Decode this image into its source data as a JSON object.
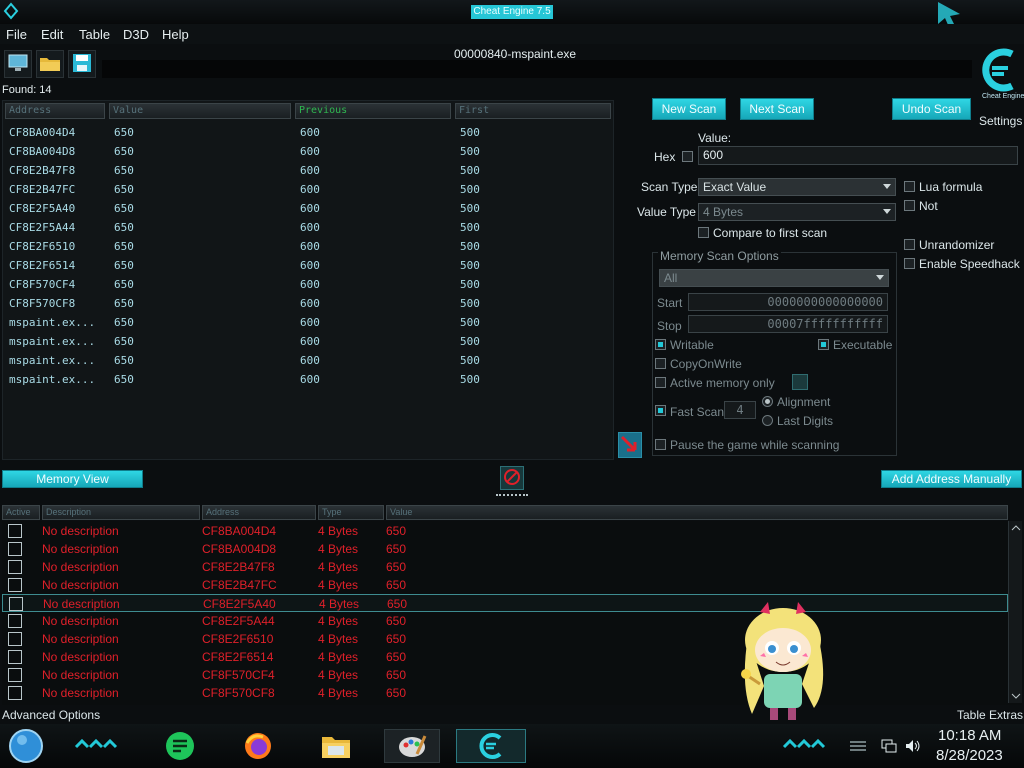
{
  "window": {
    "title": "Cheat Engine 7.5",
    "process": "00000840-mspaint.exe"
  },
  "menu": [
    "File",
    "Edit",
    "Table",
    "D3D",
    "Help"
  ],
  "toolbar": {
    "icons": [
      "open-process-icon",
      "open-file-icon",
      "save-icon"
    ]
  },
  "found": "Found: 14",
  "results": {
    "columns": [
      "Address",
      "Value",
      "Previous",
      "First"
    ],
    "rows": [
      [
        "CF8BA004D4",
        "650",
        "600",
        "500"
      ],
      [
        "CF8BA004D8",
        "650",
        "600",
        "500"
      ],
      [
        "CF8E2B47F8",
        "650",
        "600",
        "500"
      ],
      [
        "CF8E2B47FC",
        "650",
        "600",
        "500"
      ],
      [
        "CF8E2F5A40",
        "650",
        "600",
        "500"
      ],
      [
        "CF8E2F5A44",
        "650",
        "600",
        "500"
      ],
      [
        "CF8E2F6510",
        "650",
        "600",
        "500"
      ],
      [
        "CF8E2F6514",
        "650",
        "600",
        "500"
      ],
      [
        "CF8F570CF4",
        "650",
        "600",
        "500"
      ],
      [
        "CF8F570CF8",
        "650",
        "600",
        "500"
      ],
      [
        "mspaint.ex...",
        "650",
        "600",
        "500"
      ],
      [
        "mspaint.ex...",
        "650",
        "600",
        "500"
      ],
      [
        "mspaint.ex...",
        "650",
        "600",
        "500"
      ],
      [
        "mspaint.ex...",
        "650",
        "600",
        "500"
      ]
    ]
  },
  "scan": {
    "new_scan": "New Scan",
    "next_scan": "Next Scan",
    "undo_scan": "Undo Scan",
    "settings": "Settings",
    "value_label": "Value:",
    "hex_label": "Hex",
    "value": "600",
    "scan_type_label": "Scan Type",
    "scan_type": "Exact Value",
    "value_type_label": "Value Type",
    "value_type": "4 Bytes",
    "compare_first": "Compare to first scan",
    "lua_formula": "Lua formula",
    "not": "Not",
    "unrandomizer": "Unrandomizer",
    "speedhack": "Enable Speedhack"
  },
  "memory_options": {
    "title": "Memory Scan Options",
    "region": "All",
    "start_label": "Start",
    "start": "0000000000000000",
    "stop_label": "Stop",
    "stop": "00007fffffffffff",
    "writable": "Writable",
    "executable": "Executable",
    "copy_on_write": "CopyOnWrite",
    "active_memory": "Active memory only",
    "fast_scan": "Fast Scan",
    "fast_scan_value": "4",
    "alignment": "Alignment",
    "last_digits": "Last Digits",
    "pause_game": "Pause the game while scanning"
  },
  "buttons": {
    "memory_view": "Memory View",
    "add_address": "Add Address Manually"
  },
  "address_list": {
    "columns": [
      "Active",
      "Description",
      "Address",
      "Type",
      "Value"
    ],
    "rows": [
      [
        "No description",
        "CF8BA004D4",
        "4 Bytes",
        "650"
      ],
      [
        "No description",
        "CF8BA004D8",
        "4 Bytes",
        "650"
      ],
      [
        "No description",
        "CF8E2B47F8",
        "4 Bytes",
        "650"
      ],
      [
        "No description",
        "CF8E2B47FC",
        "4 Bytes",
        "650"
      ],
      [
        "No description",
        "CF8E2F5A40",
        "4 Bytes",
        "650"
      ],
      [
        "No description",
        "CF8E2F5A44",
        "4 Bytes",
        "650"
      ],
      [
        "No description",
        "CF8E2F6510",
        "4 Bytes",
        "650"
      ],
      [
        "No description",
        "CF8E2F6514",
        "4 Bytes",
        "650"
      ],
      [
        "No description",
        "CF8F570CF4",
        "4 Bytes",
        "650"
      ],
      [
        "No description",
        "CF8F570CF8",
        "4 Bytes",
        "650"
      ]
    ]
  },
  "footer": {
    "advanced": "Advanced Options",
    "table_extras": "Table Extras"
  },
  "taskbar": {
    "apps": [
      "start-orb-icon",
      "notes-app-icon",
      "firefox-icon",
      "file-explorer-icon",
      "paint-icon",
      "cheat-engine-icon"
    ],
    "time": "10:18 AM",
    "date": "8/28/2023"
  },
  "colors": {
    "accent": "#22c9d8",
    "address_text": "#e0202a",
    "results_text": "#a9dbe6"
  }
}
